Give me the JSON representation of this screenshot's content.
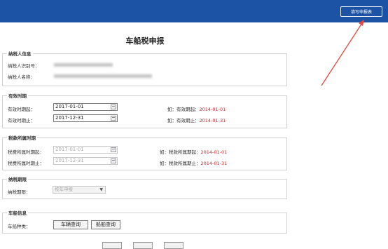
{
  "header": {
    "fill_button_label": "填写申报表"
  },
  "page": {
    "title": "车船税申报"
  },
  "taxpayer": {
    "legend": "纳税人信息",
    "id_label": "纳税人识别号：",
    "name_label": "纳税人名称："
  },
  "validity": {
    "legend": "有效时期",
    "start_label": "有效时期起：",
    "start_value": "2017-01-01",
    "end_label": "有效时期止：",
    "end_value": "2017-12-31",
    "start_hint_prefix": "如：有效期起：",
    "start_hint_example": "2014-01-01",
    "end_hint_prefix": "如：有效期止：",
    "end_hint_example": "2014-01-31"
  },
  "tax_period": {
    "legend": "税款所属时期",
    "start_label": "税费所属时期起：",
    "start_value": "2017-01-01",
    "end_label": "税费所属时期止：",
    "end_value": "2017-12-31",
    "start_hint_prefix": "如：税款所属期起：",
    "start_hint_example": "2014-01-01",
    "end_hint_prefix": "如：税款所属期止：",
    "end_hint_example": "2014-01-31"
  },
  "filing_period": {
    "legend": "纳税期限",
    "label": "纳税期限：",
    "selected": "按年申报"
  },
  "vessel": {
    "legend": "车船信息",
    "type_label": "车船种类：",
    "vehicle_query_label": "车辆查询",
    "ship_query_label": "船舶查询"
  },
  "colors": {
    "header_bg": "#1d53a4",
    "hint_red": "#e02020",
    "annotation_arrow": "#e8453c"
  }
}
